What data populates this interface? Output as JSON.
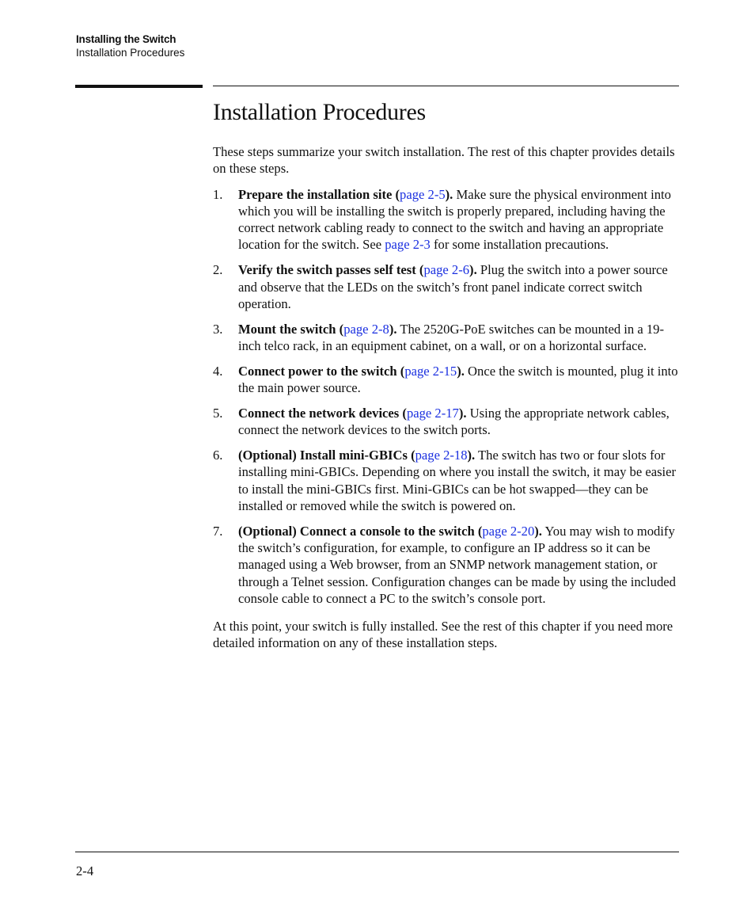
{
  "header": {
    "chapter": "Installing the Switch",
    "section": "Installation Procedures"
  },
  "title": "Installation Procedures",
  "intro": "These steps summarize your switch installation. The rest of this chapter provides details on these steps.",
  "steps": [
    {
      "num": "1.",
      "title": "Prepare the installation site",
      "link": "page 2-5",
      "body_a": " Make sure the physical environment into which you will be installing the switch is properly prepared, including having the correct network cabling ready to connect to the switch and having an appropriate location for the switch. See ",
      "link2": "page 2-3",
      "body_b": " for some installation precautions."
    },
    {
      "num": "2.",
      "title": "Verify the switch passes self test",
      "link": "page 2-6",
      "body_a": " Plug the switch into a power source and observe that the LEDs on the switch’s front panel indicate correct switch operation."
    },
    {
      "num": "3.",
      "title": "Mount the switch",
      "link": "page 2-8",
      "body_a": " The 2520G-PoE switches can be mounted in a 19-inch telco rack, in an equipment cabinet, on a wall, or on a horizontal surface."
    },
    {
      "num": "4.",
      "title": "Connect power to the switch",
      "link": "page 2-15",
      "body_a": " Once the switch is mounted, plug it into the main power source."
    },
    {
      "num": "5.",
      "title": "Connect the network devices",
      "link": "page 2-17",
      "body_a": " Using the appropriate network cables, connect the network devices to the switch ports."
    },
    {
      "num": "6.",
      "title": "(Optional) Install mini-GBICs",
      "link": "page 2-18",
      "body_a": " The switch has two or four slots for installing mini-GBICs. Depending on where you install the switch, it may be easier to install the mini-GBICs first. Mini-GBICs can be hot swapped—they can be installed or removed while the switch is powered on."
    },
    {
      "num": "7.",
      "title": "(Optional) Connect a console to the switch",
      "link": "page 2-20",
      "body_a": " You may wish to modify the switch’s configuration, for example, to configure an IP address so it can be managed using a Web browser, from an SNMP network management station, or through a Telnet session. Configuration changes can be made by using the included console cable to connect a PC to the switch’s console port."
    }
  ],
  "punct": {
    "open": " (",
    "close": ")."
  },
  "closing": "At this point, your switch is fully installed. See the rest of this chapter if you need more detailed information on any of these installation steps.",
  "footer": {
    "page_number": "2-4"
  },
  "colors": {
    "link": "#1a2fe0",
    "text": "#111111"
  }
}
